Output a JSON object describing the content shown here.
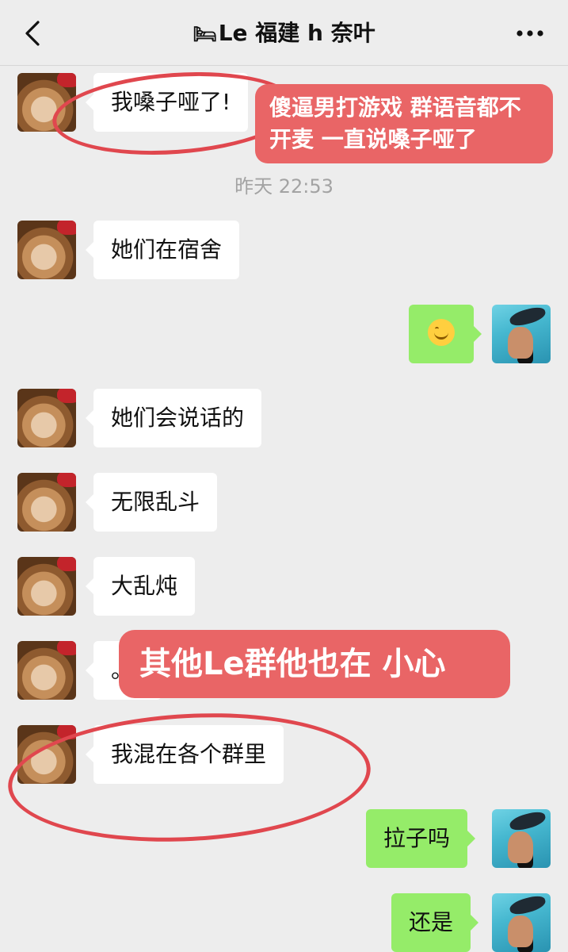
{
  "header": {
    "back_icon": "chevron-left-icon",
    "title_emoji": "🛏",
    "title": "Le 福建 h 奈叶",
    "more_icon": "more-dots-icon"
  },
  "messages": [
    {
      "side": "in",
      "text": "我嗓子哑了!"
    },
    {
      "side": "time",
      "text": "昨天 22:53"
    },
    {
      "side": "in",
      "text": "她们在宿舍"
    },
    {
      "side": "out",
      "emoji": "smile-emoji"
    },
    {
      "side": "in",
      "text": "她们会说话的"
    },
    {
      "side": "in",
      "text": "无限乱斗"
    },
    {
      "side": "in",
      "text": "大乱炖"
    },
    {
      "side": "in",
      "text": "。。"
    },
    {
      "side": "in",
      "text": "我混在各个群里"
    },
    {
      "side": "out",
      "text": "拉子吗"
    },
    {
      "side": "out",
      "text": "还是"
    }
  ],
  "annotations": {
    "note1": "傻逼男打游戏 群语音都不开麦 一直说嗓子哑了",
    "note2": "其他Le群他也在 小心",
    "color": "#e96566",
    "circle_color": "#e0474e"
  }
}
